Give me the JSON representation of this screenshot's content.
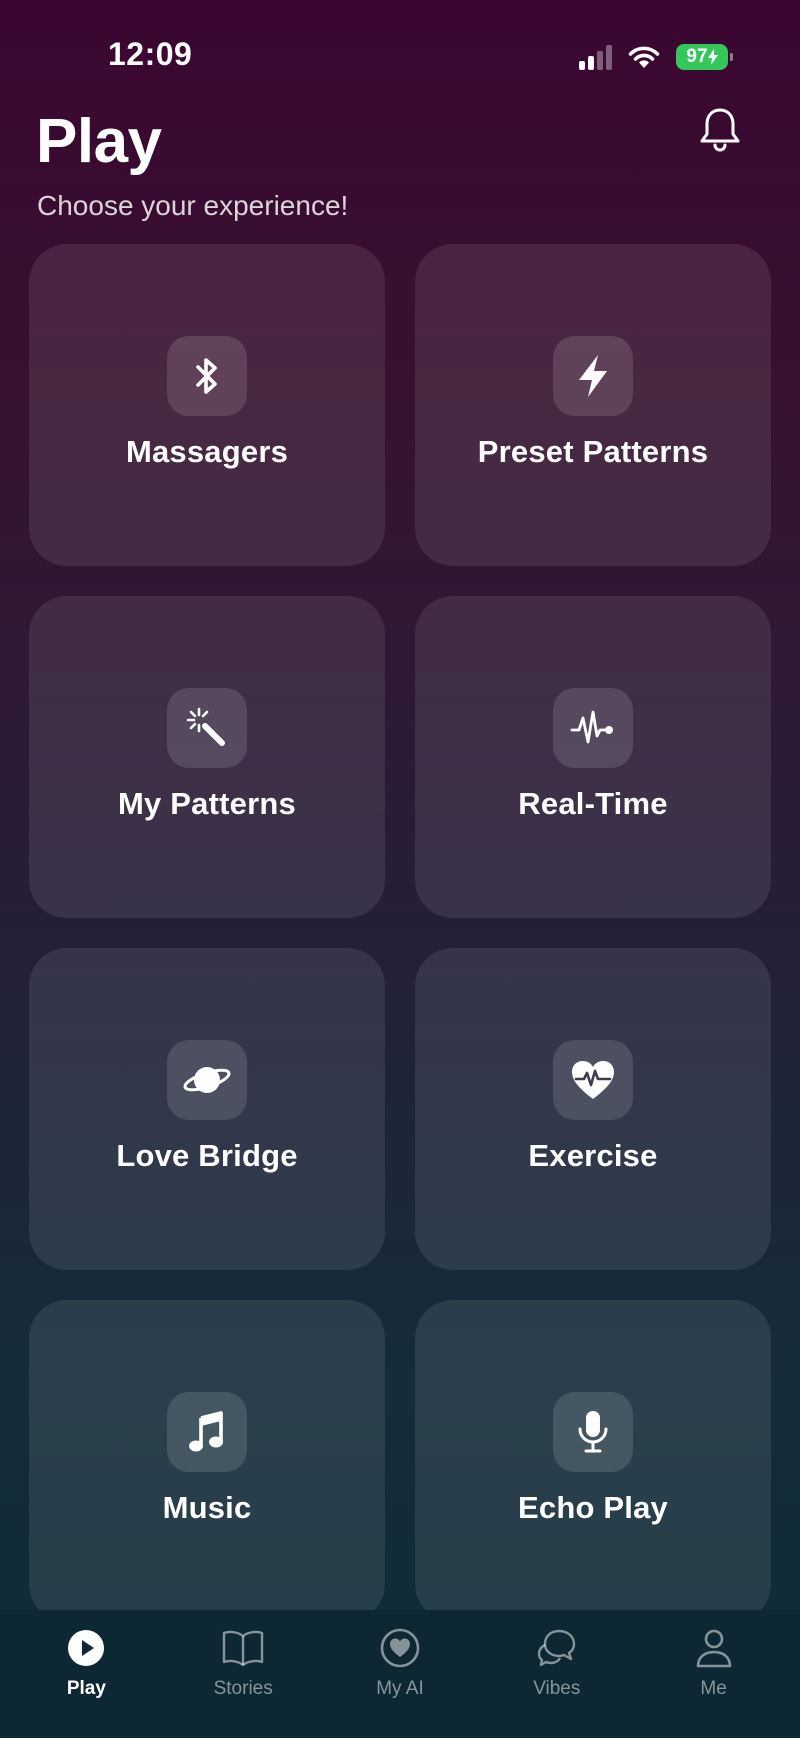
{
  "status": {
    "time": "12:09",
    "battery": "97"
  },
  "header": {
    "title": "Play",
    "subtitle": "Choose your experience!"
  },
  "cards": [
    {
      "label": "Massagers",
      "icon": "bluetooth-icon"
    },
    {
      "label": "Preset Patterns",
      "icon": "lightning-icon"
    },
    {
      "label": "My Patterns",
      "icon": "magic-wand-icon"
    },
    {
      "label": "Real-Time",
      "icon": "waveform-icon"
    },
    {
      "label": "Love Bridge",
      "icon": "planet-icon"
    },
    {
      "label": "Exercise",
      "icon": "heart-pulse-icon"
    },
    {
      "label": "Music",
      "icon": "music-note-icon"
    },
    {
      "label": "Echo Play",
      "icon": "microphone-icon"
    }
  ],
  "tabs": [
    {
      "label": "Play",
      "icon": "play-icon",
      "active": true
    },
    {
      "label": "Stories",
      "icon": "book-icon",
      "active": false
    },
    {
      "label": "My AI",
      "icon": "heart-circle-icon",
      "active": false
    },
    {
      "label": "Vibes",
      "icon": "chat-bubbles-icon",
      "active": false
    },
    {
      "label": "Me",
      "icon": "person-icon",
      "active": false
    }
  ],
  "colors": {
    "battery": "#34c759",
    "background_top": "#3b0630",
    "background_bottom": "#0f2a36",
    "tab_bar": "#0d2833"
  }
}
